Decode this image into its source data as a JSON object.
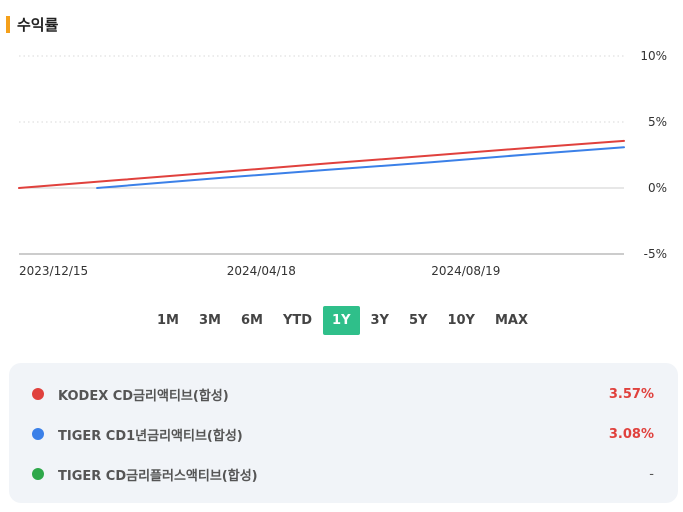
{
  "header": {
    "title": "수익률"
  },
  "periods": [
    "1M",
    "3M",
    "6M",
    "YTD",
    "1Y",
    "3Y",
    "5Y",
    "10Y",
    "MAX"
  ],
  "active_period": "1Y",
  "legend": [
    {
      "name": "KODEX CD금리액티브(합성)",
      "value": "3.57%",
      "color": "#e0413d"
    },
    {
      "name": "TIGER CD1년금리액티브(합성)",
      "value": "3.08%",
      "color": "#3b80e8"
    },
    {
      "name": "TIGER CD금리플러스액티브(합성)",
      "value": "-",
      "color": "#2ea84a"
    }
  ],
  "chart_data": {
    "type": "line",
    "x_tick_labels": [
      "2023/12/15",
      "2024/04/18",
      "2024/08/19"
    ],
    "y_tick_labels": [
      "10%",
      "5%",
      "0%",
      "-5%"
    ],
    "y_ticks": [
      10,
      5,
      0,
      -5
    ],
    "ylim": [
      -5,
      10
    ],
    "xlim": [
      "2023/12/15",
      "2024/12/13"
    ],
    "grid": true,
    "series": [
      {
        "name": "KODEX CD금리액티브(합성)",
        "color": "#e0413d",
        "x": [
          "2023/12/15",
          "2024/02/15",
          "2024/04/18",
          "2024/06/18",
          "2024/08/19",
          "2024/10/18",
          "2024/12/13"
        ],
        "y": [
          0.0,
          0.62,
          1.25,
          1.86,
          2.46,
          3.05,
          3.57
        ]
      },
      {
        "name": "TIGER CD1년금리액티브(합성)",
        "color": "#3b80e8",
        "x": [
          "2024/01/31",
          "2024/04/18",
          "2024/06/18",
          "2024/08/19",
          "2024/10/18",
          "2024/12/13"
        ],
        "y": [
          0.0,
          0.8,
          1.38,
          1.95,
          2.56,
          3.08
        ]
      },
      {
        "name": "TIGER CD금리플러스액티브(합성)",
        "color": "#2ea84a",
        "x": [],
        "y": []
      }
    ]
  }
}
